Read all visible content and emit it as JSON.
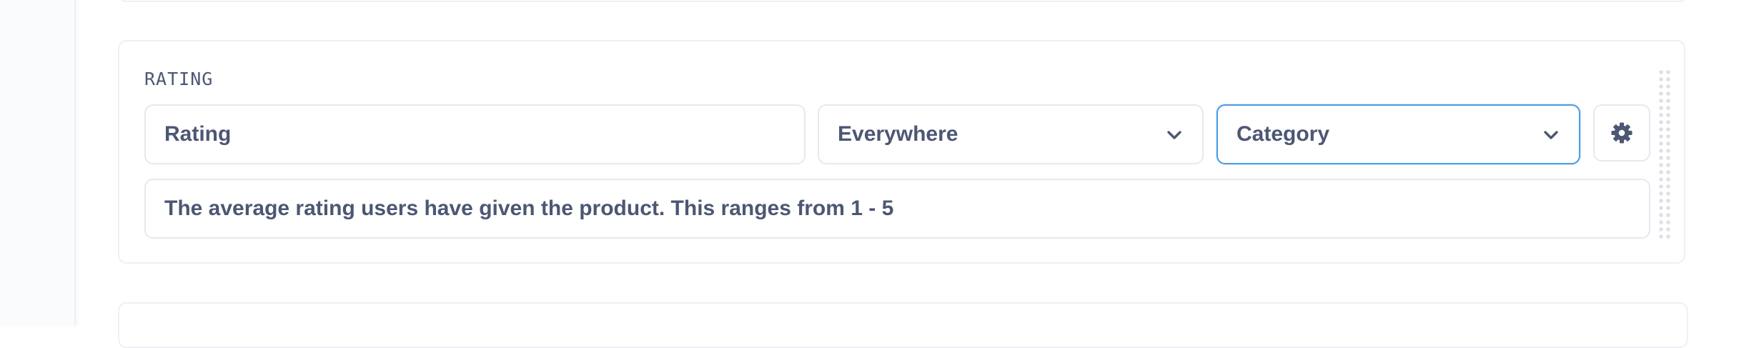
{
  "field": {
    "section_label": "RATING",
    "display_name": "Rating",
    "visibility": "Everywhere",
    "semantic_type": "Category",
    "description": "The average rating users have given the product. This ranges from 1 - 5"
  },
  "icons": {
    "visibility_dropdown": "chevron-down-icon",
    "type_dropdown": "chevron-down-icon",
    "settings": "gear-icon",
    "drag": "drag-handle-icon"
  },
  "colors": {
    "text": "#4c5773",
    "border": "#e6e9ef",
    "focus_border": "#509ee3"
  }
}
